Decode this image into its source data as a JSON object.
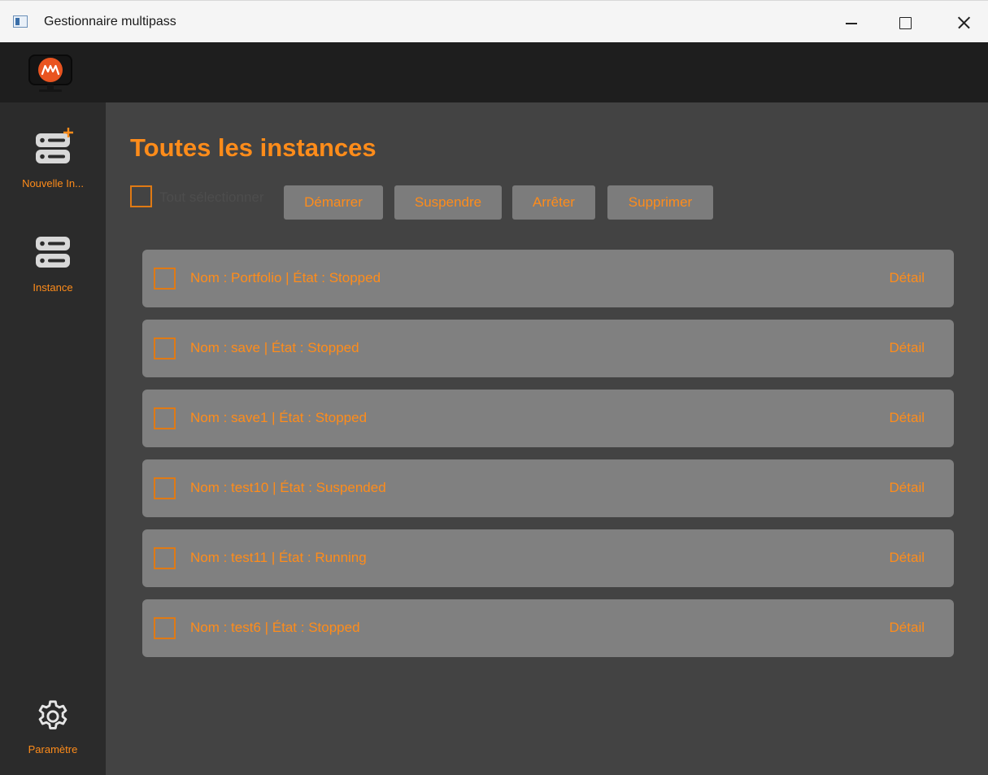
{
  "window": {
    "title": "Gestionnaire multipass",
    "icons": {
      "minimize": "minimize-icon",
      "maximize": "maximize-icon",
      "close": "close-icon"
    }
  },
  "header": {
    "logo": "multipass-logo-icon",
    "accent_color": "#ff8c1a"
  },
  "sidebar": {
    "items": [
      {
        "label": "Nouvelle In...",
        "icon": "server-add-icon"
      },
      {
        "label": "Instance",
        "icon": "server-icon"
      },
      {
        "label": "Paramètre",
        "icon": "gear-icon"
      }
    ]
  },
  "main": {
    "title": "Toutes les instances",
    "toolbar": {
      "select_all_label": "Tout sélectionner",
      "start_label": "Démarrer",
      "suspend_label": "Suspendre",
      "stop_label": "Arrêter",
      "delete_label": "Supprimer"
    },
    "instances": [
      {
        "label": "Nom : Portfolio | État : Stopped",
        "detail": "Détail"
      },
      {
        "label": "Nom : save | État : Stopped",
        "detail": "Détail"
      },
      {
        "label": "Nom : save1 | État : Stopped",
        "detail": "Détail"
      },
      {
        "label": "Nom : test10 | État : Suspended",
        "detail": "Détail"
      },
      {
        "label": "Nom : test11 | État : Running",
        "detail": "Détail"
      },
      {
        "label": "Nom : test6 | État : Stopped",
        "detail": "Détail"
      }
    ]
  }
}
